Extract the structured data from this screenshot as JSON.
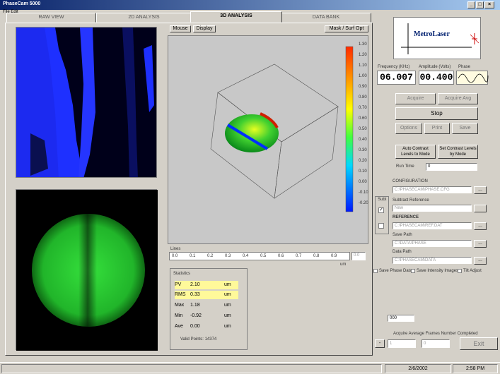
{
  "window": {
    "title": "PhaseCam 5000"
  },
  "menu": {
    "label": "File Edit"
  },
  "tabs": [
    {
      "label": "RAW VIEW"
    },
    {
      "label": "2D ANALYSIS"
    },
    {
      "label": "3D ANALYSIS"
    },
    {
      "label": "DATA BANK"
    }
  ],
  "view3d": {
    "btn_a": "Mouse",
    "btn_b": "Display",
    "btn_mask": "Mask / Surf Opt",
    "colorbar_labels": [
      "1.30",
      "1.20",
      "1.10",
      "1.00",
      "0.90",
      "0.80",
      "0.70",
      "0.60",
      "0.50",
      "0.40",
      "0.30",
      "0.20",
      "0.10",
      "0.00",
      "-0.10",
      "-0.20"
    ],
    "strip_label": "Lines",
    "strip_values": [
      "0.0",
      "0.1",
      "0.2",
      "0.3",
      "0.4",
      "0.5",
      "0.6",
      "0.7",
      "0.8",
      "0.9"
    ],
    "strip_end": "0.0",
    "strip_unit": "um"
  },
  "stats": {
    "title": "Statistics",
    "rows": [
      {
        "label": "PV",
        "value": "2.10",
        "unit": "um"
      },
      {
        "label": "RMS",
        "value": "0.33",
        "unit": "um"
      },
      {
        "label": "Max",
        "value": "1.18",
        "unit": "um"
      },
      {
        "label": "Min",
        "value": "-0.92",
        "unit": "um"
      },
      {
        "label": "Ave",
        "value": "0.00",
        "unit": "um"
      }
    ],
    "valid": "Valid Points: 14374"
  },
  "logo": {
    "text": "MetroLaser"
  },
  "controls": {
    "freq_label": "Frequency (KHz)",
    "amp_label": "Amplitude (Volts)",
    "phase_label": "Phase",
    "freq_value": "06.007",
    "amp_value": "00.400",
    "btn_acquire": "Acquire",
    "btn_average": "Acquire Avg",
    "btn_stop": "Stop",
    "btn_options": "Options",
    "btn_print": "Print",
    "btn_save": "Save",
    "btn_auto_contrast": "Auto Contrast Levels to Mode",
    "btn_set_contrast": "Set Contrast Levels by Mode",
    "frame_label": "Run Time",
    "frame_value": "0",
    "config_label": "CONFIGURATION",
    "config_path": "C:\\PHASECAM\\PHASE.CFG",
    "subt_label": "Subt",
    "subtract_label": "Subtract Reference",
    "subtract_value": "New",
    "ref_label": "REFERENCE",
    "ref_path": "C:\\PHASECAM\\REF.DAT",
    "save_label": "Save Path",
    "save_path": "C:\\DATA\\PHASE",
    "data_label": "Data Path",
    "data_path": "C:\\PHASECAM\\DATA",
    "chk1": "Save Phase Data",
    "chk2": "Save Intensity Images",
    "chk3": "Tilt Adjust",
    "small_field": "000",
    "bottom_lbl": "Acquire Average Frames  Number Completed",
    "btn_minus": "-",
    "btn_exit": "Exit",
    "bottom_a": "1",
    "bottom_b": "0"
  },
  "status": {
    "date": "2/6/2002",
    "time": "2:58 PM"
  },
  "colors": {
    "titlebar": "#0a246a",
    "highlight": "#fff99a",
    "phase_blue": "#1e30ff",
    "intensity_green": "#21c52c"
  }
}
